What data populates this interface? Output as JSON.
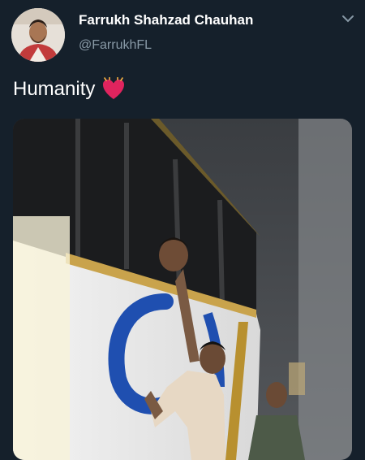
{
  "tweet": {
    "author_name": "Farrukh Shahzad Chauhan",
    "author_handle": "@FarrukhFL",
    "text": "Humanity",
    "emoji_icon": "heart-eyes-red-heart-icon",
    "menu_icon": "chevron-down-icon"
  },
  "colors": {
    "background": "#15202b",
    "name": "#ffffff",
    "handle": "#8899a6",
    "heart": "#e0245e",
    "bus_logo": "#1f4fb0"
  }
}
